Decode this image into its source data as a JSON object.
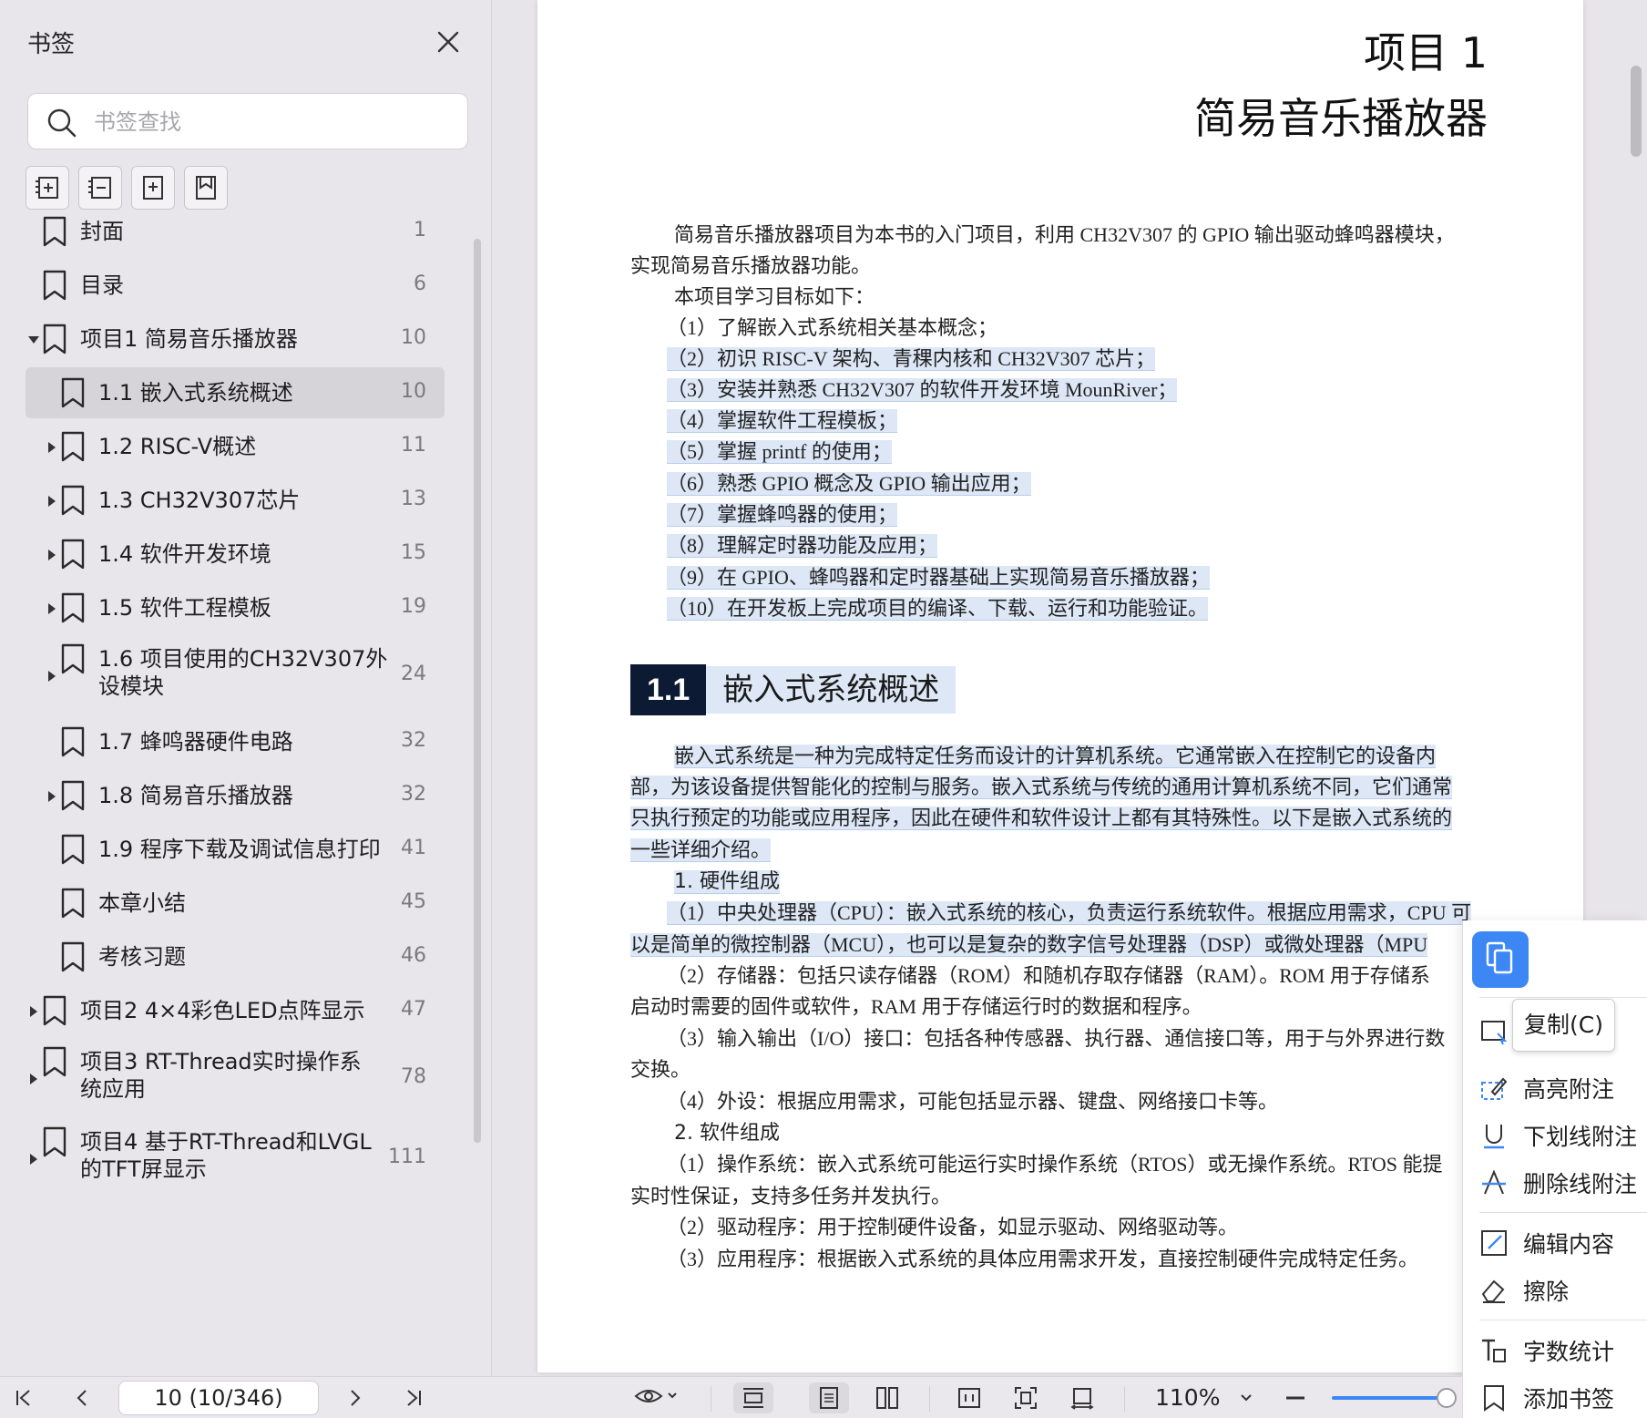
{
  "sidebar": {
    "title": "书签",
    "search_placeholder": "书签查找",
    "bookmarks": [
      {
        "label": "封面",
        "page": "1"
      },
      {
        "label": "目录",
        "page": "6"
      },
      {
        "label": "项目1 简易音乐播放器",
        "page": "10"
      },
      {
        "label": "1.1 嵌入式系统概述",
        "page": "10"
      },
      {
        "label": "1.2 RISC-V概述",
        "page": "11"
      },
      {
        "label": "1.3 CH32V307芯片",
        "page": "13"
      },
      {
        "label": "1.4 软件开发环境",
        "page": "15"
      },
      {
        "label": "1.5 软件工程模板",
        "page": "19"
      },
      {
        "label": "1.6 项目使用的CH32V307外",
        "label2": "设模块",
        "page": "24"
      },
      {
        "label": "1.7 蜂鸣器硬件电路",
        "page": "32"
      },
      {
        "label": "1.8 简易音乐播放器",
        "page": "32"
      },
      {
        "label": "1.9 程序下载及调试信息打印",
        "page": "41"
      },
      {
        "label": "本章小结",
        "page": "45"
      },
      {
        "label": "考核习题",
        "page": "46"
      },
      {
        "label": "项目2 4×4彩色LED点阵显示",
        "page": "47"
      },
      {
        "label": "项目3 RT-Thread实时操作系",
        "label2": "统应用",
        "page": "78"
      },
      {
        "label": "项目4 基于RT-Thread和LVGL",
        "label2": "的TFT屏显示",
        "page": "111"
      }
    ]
  },
  "document": {
    "title_line1": "项目 1",
    "title_line2": "简易音乐播放器",
    "intro_1": "简易音乐播放器项目为本书的入门项目，利用 CH32V307 的 GPIO 输出驱动蜂鸣器模块，",
    "intro_2": "实现简易音乐播放器功能。",
    "goals_head": "本项目学习目标如下：",
    "goal_1": "（1）了解嵌入式系统相关基本概念；",
    "goal_2": "（2）初识 RISC-V 架构、青稞内核和 CH32V307 芯片；",
    "goal_3": "（3）安装并熟悉 CH32V307 的软件开发环境 MounRiver；",
    "goal_4": "（4）掌握软件工程模板；",
    "goal_5": "（5）掌握 printf 的使用；",
    "goal_6": "（6）熟悉 GPIO 概念及 GPIO 输出应用；",
    "goal_7": "（7）掌握蜂鸣器的使用；",
    "goal_8": "（8）理解定时器功能及应用；",
    "goal_9": "（9）在 GPIO、蜂鸣器和定时器基础上实现简易音乐播放器；",
    "goal_10": "（10）在开发板上完成项目的编译、下载、运行和功能验证。",
    "section_num": "1.1",
    "section_title": "嵌入式系统概述",
    "para1_1": "嵌入式系统是一种为完成特定任务而设计的计算机系统。它通常嵌入在控制它的设备内",
    "para1_2": "部，为该设备提供智能化的控制与服务。嵌入式系统与传统的通用计算机系统不同，它们通常",
    "para1_3": "只执行预定的功能或应用程序，因此在硬件和软件设计上都有其特殊性。以下是嵌入式系统的",
    "para1_4": "一些详细介绍。",
    "hw_head": "1.  硬件组成",
    "hw1_1": "（1）中央处理器（CPU）：嵌入式系统的核心，负责运行系统软件。根据应用需求，CPU 可",
    "hw1_2": "以是简单的微控制器（MCU），也可以是复杂的数字信号处理器（DSP）或微处理器（MPU",
    "hw2_1": "（2）存储器：包括只读存储器（ROM）和随机存取存储器（RAM）。ROM 用于存储系",
    "hw2_2": "启动时需要的固件或软件，RAM 用于存储运行时的数据和程序。",
    "hw3_1": "（3）输入输出（I/O）接口：包括各种传感器、执行器、通信接口等，用于与外界进行数",
    "hw3_2": "交换。",
    "hw4": "（4）外设：根据应用需求，可能包括显示器、键盘、网络接口卡等。",
    "sw_head": "2.  软件组成",
    "sw1_1": "（1）操作系统：嵌入式系统可能运行实时操作系统（RTOS）或无操作系统。RTOS 能提",
    "sw1_2": "实时性保证，支持多任务并发执行。",
    "sw2": "（2）驱动程序：用于控制硬件设备，如显示驱动、网络驱动等。",
    "sw3": "（3）应用程序：根据嵌入式系统的具体应用需求开发，直接控制硬件完成特定任务。"
  },
  "context_menu": {
    "tooltip": "复制(C)",
    "items": [
      "高亮附注",
      "下划线附注",
      "删除线附注",
      "编辑内容",
      "擦除",
      "字数统计",
      "添加书签"
    ]
  },
  "bottombar": {
    "page_field": "10 (10/346)",
    "zoom": "110%",
    "zoom_fraction": 0.9
  },
  "colors": {
    "accent": "#3d87f5",
    "selection": "#dde7f6",
    "heading_block": "#0c1a33"
  }
}
